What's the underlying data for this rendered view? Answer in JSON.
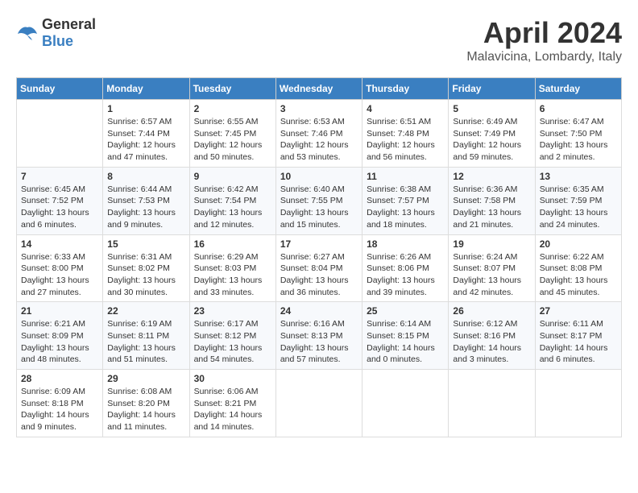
{
  "header": {
    "logo_general": "General",
    "logo_blue": "Blue",
    "month_year": "April 2024",
    "location": "Malavicina, Lombardy, Italy"
  },
  "calendar": {
    "weekdays": [
      "Sunday",
      "Monday",
      "Tuesday",
      "Wednesday",
      "Thursday",
      "Friday",
      "Saturday"
    ],
    "weeks": [
      [
        {
          "day": "",
          "info": ""
        },
        {
          "day": "1",
          "info": "Sunrise: 6:57 AM\nSunset: 7:44 PM\nDaylight: 12 hours\nand 47 minutes."
        },
        {
          "day": "2",
          "info": "Sunrise: 6:55 AM\nSunset: 7:45 PM\nDaylight: 12 hours\nand 50 minutes."
        },
        {
          "day": "3",
          "info": "Sunrise: 6:53 AM\nSunset: 7:46 PM\nDaylight: 12 hours\nand 53 minutes."
        },
        {
          "day": "4",
          "info": "Sunrise: 6:51 AM\nSunset: 7:48 PM\nDaylight: 12 hours\nand 56 minutes."
        },
        {
          "day": "5",
          "info": "Sunrise: 6:49 AM\nSunset: 7:49 PM\nDaylight: 12 hours\nand 59 minutes."
        },
        {
          "day": "6",
          "info": "Sunrise: 6:47 AM\nSunset: 7:50 PM\nDaylight: 13 hours\nand 2 minutes."
        }
      ],
      [
        {
          "day": "7",
          "info": "Sunrise: 6:45 AM\nSunset: 7:52 PM\nDaylight: 13 hours\nand 6 minutes."
        },
        {
          "day": "8",
          "info": "Sunrise: 6:44 AM\nSunset: 7:53 PM\nDaylight: 13 hours\nand 9 minutes."
        },
        {
          "day": "9",
          "info": "Sunrise: 6:42 AM\nSunset: 7:54 PM\nDaylight: 13 hours\nand 12 minutes."
        },
        {
          "day": "10",
          "info": "Sunrise: 6:40 AM\nSunset: 7:55 PM\nDaylight: 13 hours\nand 15 minutes."
        },
        {
          "day": "11",
          "info": "Sunrise: 6:38 AM\nSunset: 7:57 PM\nDaylight: 13 hours\nand 18 minutes."
        },
        {
          "day": "12",
          "info": "Sunrise: 6:36 AM\nSunset: 7:58 PM\nDaylight: 13 hours\nand 21 minutes."
        },
        {
          "day": "13",
          "info": "Sunrise: 6:35 AM\nSunset: 7:59 PM\nDaylight: 13 hours\nand 24 minutes."
        }
      ],
      [
        {
          "day": "14",
          "info": "Sunrise: 6:33 AM\nSunset: 8:00 PM\nDaylight: 13 hours\nand 27 minutes."
        },
        {
          "day": "15",
          "info": "Sunrise: 6:31 AM\nSunset: 8:02 PM\nDaylight: 13 hours\nand 30 minutes."
        },
        {
          "day": "16",
          "info": "Sunrise: 6:29 AM\nSunset: 8:03 PM\nDaylight: 13 hours\nand 33 minutes."
        },
        {
          "day": "17",
          "info": "Sunrise: 6:27 AM\nSunset: 8:04 PM\nDaylight: 13 hours\nand 36 minutes."
        },
        {
          "day": "18",
          "info": "Sunrise: 6:26 AM\nSunset: 8:06 PM\nDaylight: 13 hours\nand 39 minutes."
        },
        {
          "day": "19",
          "info": "Sunrise: 6:24 AM\nSunset: 8:07 PM\nDaylight: 13 hours\nand 42 minutes."
        },
        {
          "day": "20",
          "info": "Sunrise: 6:22 AM\nSunset: 8:08 PM\nDaylight: 13 hours\nand 45 minutes."
        }
      ],
      [
        {
          "day": "21",
          "info": "Sunrise: 6:21 AM\nSunset: 8:09 PM\nDaylight: 13 hours\nand 48 minutes."
        },
        {
          "day": "22",
          "info": "Sunrise: 6:19 AM\nSunset: 8:11 PM\nDaylight: 13 hours\nand 51 minutes."
        },
        {
          "day": "23",
          "info": "Sunrise: 6:17 AM\nSunset: 8:12 PM\nDaylight: 13 hours\nand 54 minutes."
        },
        {
          "day": "24",
          "info": "Sunrise: 6:16 AM\nSunset: 8:13 PM\nDaylight: 13 hours\nand 57 minutes."
        },
        {
          "day": "25",
          "info": "Sunrise: 6:14 AM\nSunset: 8:15 PM\nDaylight: 14 hours\nand 0 minutes."
        },
        {
          "day": "26",
          "info": "Sunrise: 6:12 AM\nSunset: 8:16 PM\nDaylight: 14 hours\nand 3 minutes."
        },
        {
          "day": "27",
          "info": "Sunrise: 6:11 AM\nSunset: 8:17 PM\nDaylight: 14 hours\nand 6 minutes."
        }
      ],
      [
        {
          "day": "28",
          "info": "Sunrise: 6:09 AM\nSunset: 8:18 PM\nDaylight: 14 hours\nand 9 minutes."
        },
        {
          "day": "29",
          "info": "Sunrise: 6:08 AM\nSunset: 8:20 PM\nDaylight: 14 hours\nand 11 minutes."
        },
        {
          "day": "30",
          "info": "Sunrise: 6:06 AM\nSunset: 8:21 PM\nDaylight: 14 hours\nand 14 minutes."
        },
        {
          "day": "",
          "info": ""
        },
        {
          "day": "",
          "info": ""
        },
        {
          "day": "",
          "info": ""
        },
        {
          "day": "",
          "info": ""
        }
      ]
    ]
  }
}
